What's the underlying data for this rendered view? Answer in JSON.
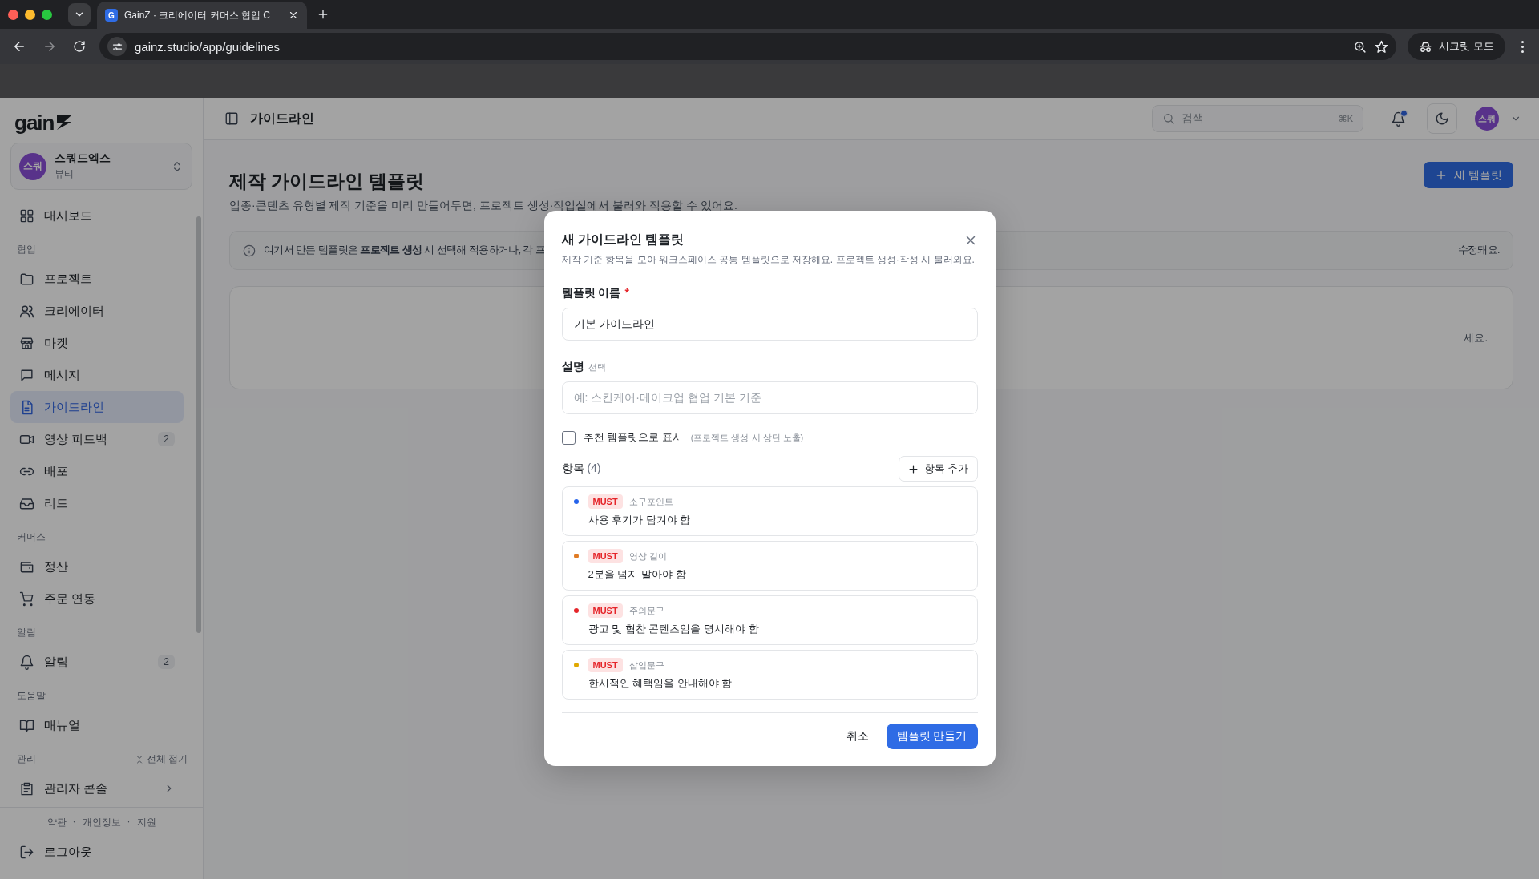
{
  "browser": {
    "tab_favicon": "G",
    "tab_title": "GainZ · 크리에이터 커머스 협업 C",
    "url": "gainz.studio/app/guidelines",
    "profile": "시크릿 모드"
  },
  "sidebar": {
    "logo": "gain",
    "workspace": {
      "avatar": "스쿼",
      "name": "스쿼드엑스",
      "category": "뷰티"
    },
    "sections": [
      {
        "items": [
          {
            "label": "대시보드",
            "selected": false
          }
        ]
      },
      {
        "label": "협업",
        "items": [
          {
            "label": "프로젝트",
            "selected": false
          },
          {
            "label": "크리에이터",
            "selected": false
          },
          {
            "label": "마켓",
            "selected": false
          },
          {
            "label": "메시지",
            "selected": false
          },
          {
            "label": "가이드라인",
            "selected": true
          },
          {
            "label": "영상 피드백",
            "selected": false,
            "badge": "2"
          },
          {
            "label": "배포",
            "selected": false
          },
          {
            "label": "리드",
            "selected": false
          }
        ]
      },
      {
        "label": "커머스",
        "items": [
          {
            "label": "정산",
            "selected": false
          },
          {
            "label": "주문 연동",
            "selected": false
          }
        ]
      },
      {
        "label": "알림",
        "items": [
          {
            "label": "알림",
            "selected": false,
            "badge": "2"
          }
        ]
      },
      {
        "label": "도움말",
        "items": [
          {
            "label": "매뉴얼",
            "selected": false
          }
        ]
      },
      {
        "label": "관리",
        "action": "전체 접기",
        "items": [
          {
            "label": "관리자 콘솔",
            "selected": false
          }
        ]
      }
    ],
    "footer_links": [
      "약관",
      "개인정보",
      "지원"
    ],
    "separator": "·",
    "logout": "로그아웃"
  },
  "header": {
    "title": "가이드라인",
    "search_placeholder": "검색",
    "shortcut": "⌘K",
    "has_notification": true,
    "avatar": "스쿼"
  },
  "page": {
    "title": "제작 가이드라인 템플릿",
    "subtitle": "업종·콘텐츠 유형별 제작 기준을 미리 만들어두면, 프로젝트 생성·작업실에서 불러와 적용할 수 있어요.",
    "new_button": "새 템플릿",
    "info_start": "여기서 만든 템플릿은 **프로젝트 생성** 시 선택해 적용하거나, 각 프",
    "info_end": "수정돼요.",
    "empty_text_end": "세요."
  },
  "modal": {
    "title": "새 가이드라인 템플릿",
    "description": "제작 기준 항목을 모아 워크스페이스 공통 템플릿으로 저장해요. 프로젝트 생성·작성 시 불러와요.",
    "name_label": "템플릿 이름",
    "required_mark": "*",
    "name_value": "기본 가이드라인",
    "desc_label": "설명",
    "desc_hint": "선택",
    "desc_placeholder": "예: 스킨케어·메이크업 협업 기본 기준",
    "featured": {
      "label": "추천 템플릿으로 표시",
      "hint": "(프로젝트 생성 시 상단 노출)",
      "checked": false
    },
    "items_label": "항목",
    "items_count": "(4)",
    "add_button": "항목 추가",
    "items": [
      {
        "color": "#2563eb",
        "badge": "MUST",
        "category": "소구포인트",
        "text": "사용 후기가 담겨야 함"
      },
      {
        "color": "#e07b24",
        "badge": "MUST",
        "category": "영상 길이",
        "text": "2분을 넘지 말아야 함"
      },
      {
        "color": "#e5252a",
        "badge": "MUST",
        "category": "주의문구",
        "text": "광고 및 협찬 콘텐츠임을 명시해야 함"
      },
      {
        "color": "#e0a800",
        "badge": "MUST",
        "category": "삽입문구",
        "text": "한시적인 혜택임을 안내해야 함"
      }
    ],
    "cancel": "취소",
    "submit": "템플릿 만들기"
  }
}
